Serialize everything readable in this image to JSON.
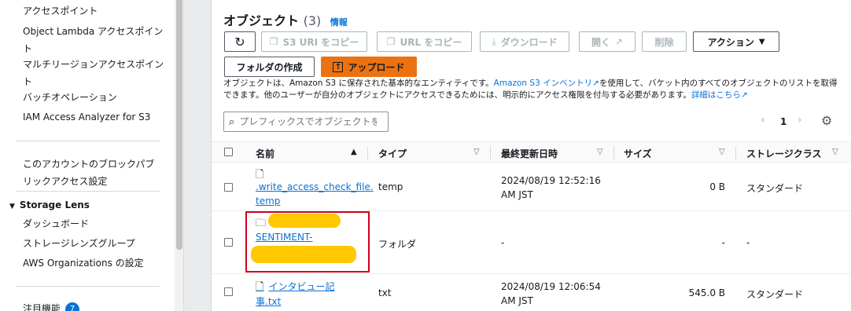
{
  "sidebar": {
    "items": [
      {
        "label": "アクセスポイント"
      },
      {
        "label": "Object Lambda アクセスポイント"
      },
      {
        "label": "マルチリージョンアクセスポイント"
      },
      {
        "label": "バッチオペレーション"
      },
      {
        "label": "IAM Access Analyzer for S3"
      },
      {
        "label": "このアカウントのブロックパブリックアクセス設定"
      }
    ],
    "storage_lens": {
      "title": "Storage Lens",
      "items": [
        {
          "label": "ダッシュボード"
        },
        {
          "label": "ストレージレンズグループ"
        },
        {
          "label": "AWS Organizations の設定"
        }
      ]
    },
    "featured": {
      "label": "注目機能",
      "count": "7"
    }
  },
  "panel": {
    "title": "オブジェクト",
    "count": "(3)",
    "info": "情報",
    "toolbar": {
      "copy_s3_uri": "S3 URI をコピー",
      "copy_url": "URL をコピー",
      "download": "ダウンロード",
      "open": "開く",
      "delete": "削除",
      "actions": "アクション",
      "create_folder": "フォルダの作成",
      "upload": "アップロード"
    },
    "description": {
      "part1": "オブジェクトは、Amazon S3 に保存された基本的なエンティティです。",
      "link1": "Amazon S3 インベントリ",
      "part2": "を使用して、バケット内のすべてのオブジェクトのリストを取得できます。他のユーザーが自分のオブジェクトにアクセスできるためには、明示的にアクセス権限を付与する必要があります。",
      "link2": "詳細はこちら"
    },
    "search": {
      "placeholder": "プレフィックスでオブジェクトを検索"
    },
    "pagination": {
      "page": "1"
    },
    "table": {
      "columns": [
        "名前",
        "タイプ",
        "最終更新日時",
        "サイズ",
        "ストレージクラス"
      ],
      "rows": [
        {
          "name_line1": ".write_access_check_file.",
          "name_line2": "temp",
          "type": "temp",
          "modified_line1": "2024/08/19 12:52:16",
          "modified_line2": "AM JST",
          "size": "0 B",
          "storage_class": "スタンダード"
        },
        {
          "name_line1": "",
          "name_line2": "SENTIMENT-",
          "name_line3": "",
          "type": "フォルダ",
          "modified_line1": "-",
          "modified_line2": "",
          "size": "-",
          "storage_class": "-"
        },
        {
          "name_line1": "インタビュー記",
          "name_line2": "事.txt",
          "type": "txt",
          "modified_line1": "2024/08/19 12:06:54",
          "modified_line2": "AM JST",
          "size": "545.0 B",
          "storage_class": "スタンダード"
        }
      ]
    }
  },
  "colors": {
    "accent": "#0972d3",
    "primary_button": "#ec7211",
    "highlight": "#d0021b",
    "redaction": "#ffc800"
  }
}
